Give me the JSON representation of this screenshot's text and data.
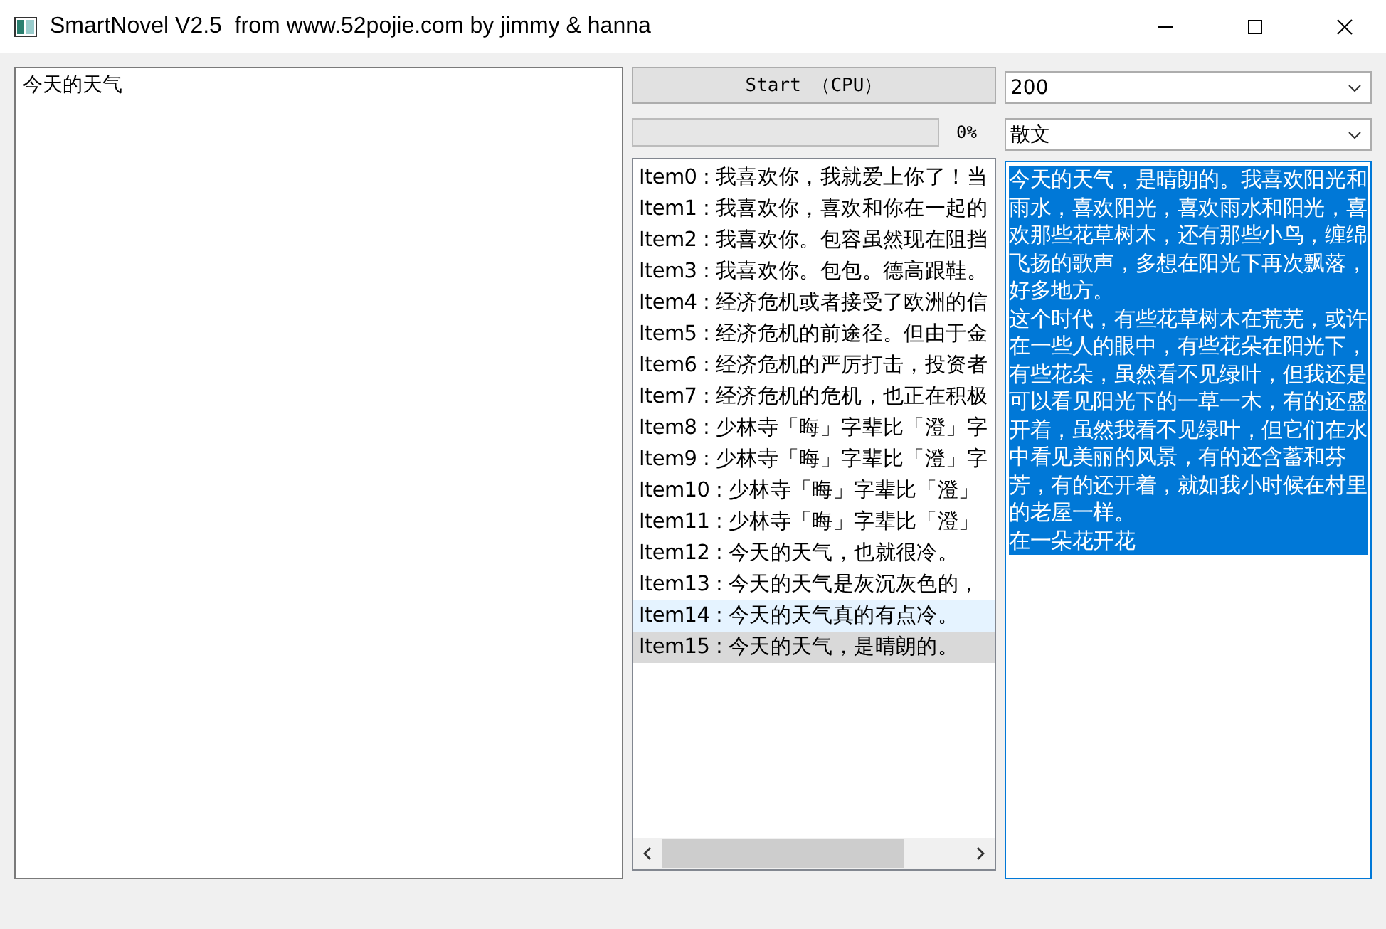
{
  "window": {
    "title": "SmartNovel V2.5  from www.52pojie.com by jimmy & hanna"
  },
  "prompt_box": {
    "value": "今天的天气"
  },
  "start_button": {
    "label": "Start （CPU）"
  },
  "progress": {
    "level": 0,
    "reading": "0%"
  },
  "length_select": {
    "value": "200"
  },
  "style_select": {
    "value": "散文"
  },
  "results": [
    {
      "label": "Item0 : 我喜欢你，我就爱上你了！当",
      "selected": false,
      "hovered": false
    },
    {
      "label": "Item1 : 我喜欢你，喜欢和你在一起的",
      "selected": false,
      "hovered": false
    },
    {
      "label": "Item2 : 我喜欢你。包容虽然现在阻挡",
      "selected": false,
      "hovered": false
    },
    {
      "label": "Item3 : 我喜欢你。包包。德高跟鞋。",
      "selected": false,
      "hovered": false
    },
    {
      "label": "Item4 : 经济危机或者接受了欧洲的信",
      "selected": false,
      "hovered": false
    },
    {
      "label": "Item5 : 经济危机的前途径。但由于金",
      "selected": false,
      "hovered": false
    },
    {
      "label": "Item6 : 经济危机的严厉打击，投资者",
      "selected": false,
      "hovered": false
    },
    {
      "label": "Item7 : 经济危机的危机，也正在积极",
      "selected": false,
      "hovered": false
    },
    {
      "label": "Item8 : 少林寺「晦」字辈比「澄」字",
      "selected": false,
      "hovered": false
    },
    {
      "label": "Item9 : 少林寺「晦」字辈比「澄」字",
      "selected": false,
      "hovered": false
    },
    {
      "label": "Item10 : 少林寺「晦」字辈比「澄」",
      "selected": false,
      "hovered": false
    },
    {
      "label": "Item11 : 少林寺「晦」字辈比「澄」",
      "selected": false,
      "hovered": false
    },
    {
      "label": "Item12 : 今天的天气，也就很冷。",
      "selected": false,
      "hovered": false
    },
    {
      "label": "Item13 : 今天的天气是灰沉灰色的，",
      "selected": false,
      "hovered": false
    },
    {
      "label": "Item14 : 今天的天气真的有点冷。",
      "selected": false,
      "hovered": true
    },
    {
      "label": "Item15 : 今天的天气，是晴朗的。",
      "selected": true,
      "hovered": false
    }
  ],
  "output": {
    "selected": true,
    "paragraphs": [
      "今天的天气，是晴朗的。我喜欢阳光和雨水，喜欢阳光，喜欢雨水和阳光，喜欢那些花草树木，还有那些小鸟，缠绵飞扬的歌声，多想在阳光下再次飘落，好多地方。",
      "这个时代，有些花草树木在荒芜，或许在一些人的眼中，有些花朵在阳光下，有些花朵，虽然看不见绿叶，但我还是可以看见阳光下的一草一木，有的还盛开着，虽然我看不见绿叶，但它们在水中看见美丽的风景，有的还含蓄和芬芳，有的还开着，就如我小时候在村里的老屋一样。",
      "在一朵花开花"
    ]
  }
}
